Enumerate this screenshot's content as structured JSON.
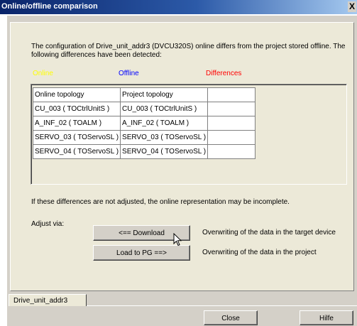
{
  "window": {
    "title": "Online/offline comparison",
    "close_glyph": "X"
  },
  "message": "The configuration of Drive_unit_addr3 (DVCU320S) online differs  from the project stored offline. The following differences have been detected:",
  "legend": {
    "online": "Online",
    "offline": "Offline",
    "differences": "Differences",
    "colors": {
      "online": "#ffff00",
      "offline": "#0000ff",
      "differences": "#ff0000"
    }
  },
  "table": {
    "rows": [
      [
        "Online topology",
        "Project topology",
        ""
      ],
      [
        "CU_003 ( TOCtrlUnitS )",
        "CU_003 ( TOCtrlUnitS )",
        ""
      ],
      [
        "A_INF_02 ( TOALM )",
        "A_INF_02 ( TOALM )",
        ""
      ],
      [
        "SERVO_03 ( TOServoSL )",
        "SERVO_03 ( TOServoSL )",
        ""
      ],
      [
        "SERVO_04 ( TOServoSL )",
        "SERVO_04 ( TOServoSL )",
        ""
      ]
    ]
  },
  "warning": "If these differences are not adjusted, the online representation may be incomplete.",
  "adjust": {
    "label": "Adjust via:",
    "download_label": "<== Download",
    "download_desc": "Overwriting of the data in the target device",
    "load_label": "Load to PG ==>",
    "load_desc": "Overwriting of the data in the project"
  },
  "tab": {
    "label": "Drive_unit_addr3"
  },
  "footer": {
    "close_label": "Close",
    "help_label": "Hilfe"
  }
}
